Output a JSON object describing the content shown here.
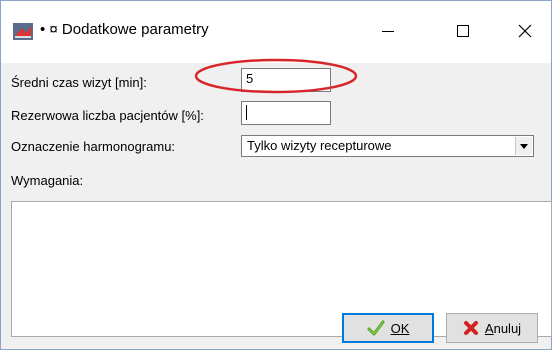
{
  "window": {
    "title": "• ¤ Dodatkowe parametry",
    "controls": {
      "minimize": "minimize",
      "maximize": "maximize",
      "close": "close"
    }
  },
  "form": {
    "avg_visit_time": {
      "label": "Średni czas wizyt [min]:",
      "value": "5"
    },
    "reserve_patients": {
      "label": "Rezerwowa liczba pacjentów [%]:",
      "value": ""
    },
    "schedule_marking": {
      "label": "Oznaczenie harmonogramu:",
      "selected": "Tylko wizyty recepturowe"
    },
    "requirements": {
      "label": "Wymagania:",
      "value": ""
    }
  },
  "buttons": {
    "ok": {
      "label": "OK",
      "icon": "checkmark-icon"
    },
    "cancel": {
      "label": "Anuluj",
      "icon": "red-x-icon"
    }
  },
  "colors": {
    "annotation": "#d7262b",
    "focus_border": "#0078d7",
    "dialog_bg": "#f0f0f0"
  }
}
